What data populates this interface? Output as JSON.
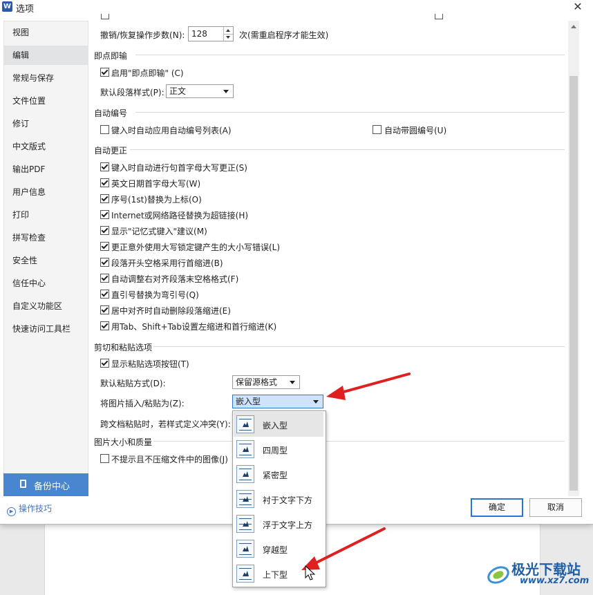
{
  "window": {
    "title": "选项",
    "app_logo": "W"
  },
  "sidebar": {
    "items": [
      {
        "label": "视图"
      },
      {
        "label": "编辑",
        "active": true
      },
      {
        "label": "常规与保存"
      },
      {
        "label": "文件位置"
      },
      {
        "label": "修订"
      },
      {
        "label": "中文版式"
      },
      {
        "label": "输出PDF"
      },
      {
        "label": "用户信息"
      },
      {
        "label": "打印"
      },
      {
        "label": "拼写检查"
      },
      {
        "label": "安全性"
      },
      {
        "label": "信任中心"
      },
      {
        "label": "自定义功能区"
      },
      {
        "label": "快速访问工具栏"
      }
    ],
    "backup_label": "备份中心",
    "tips_label": "操作技巧"
  },
  "content": {
    "undo": {
      "label": "撤销/恢复操作步数(N):",
      "value": "128",
      "note": "次(需重启程序才能生效)"
    },
    "click_type": {
      "title": "即点即输",
      "enable_label": "启用\"即点即输\" (C)",
      "enable_checked": true,
      "style_label": "默认段落样式(P):",
      "style_value": "正文"
    },
    "auto_number": {
      "title": "自动编号",
      "opt1": "键入时自动应用自动编号列表(A)",
      "opt1_checked": false,
      "opt2": "自动带圆编号(U)",
      "opt2_checked": false
    },
    "auto_correct": {
      "title": "自动更正",
      "options": [
        {
          "label": "键入时自动进行句首字母大写更正(S)",
          "checked": true
        },
        {
          "label": "英文日期首字母大写(W)",
          "checked": true
        },
        {
          "label": "序号(1st)替换为上标(O)",
          "checked": true
        },
        {
          "label": "Internet或网络路径替换为超链接(H)",
          "checked": true
        },
        {
          "label": "显示\"记忆式键入\"建议(M)",
          "checked": true
        },
        {
          "label": "更正意外使用大写锁定键产生的大小写错误(L)",
          "checked": true
        },
        {
          "label": "段落开头空格采用行首缩进(B)",
          "checked": true
        },
        {
          "label": "自动调整右对齐段落末空格格式(F)",
          "checked": true
        },
        {
          "label": "直引号替换为弯引号(Q)",
          "checked": true
        },
        {
          "label": "居中对齐时自动删除段落缩进(E)",
          "checked": true
        },
        {
          "label": "用Tab、Shift+Tab设置左缩进和首行缩进(K)",
          "checked": true
        }
      ]
    },
    "paste": {
      "title": "剪切和粘贴选项",
      "show_btn_label": "显示粘贴选项按钮(T)",
      "show_btn_checked": true,
      "default_label": "默认粘贴方式(D):",
      "default_value": "保留源格式",
      "image_label": "将图片插入/粘贴为(Z):",
      "image_value": "嵌入型",
      "conflict_label": "跨文档粘贴时，若样式定义冲突(Y):"
    },
    "image_quality": {
      "title": "图片大小和质量",
      "no_compress_label": "不提示且不压缩文件中的图像(J)",
      "no_compress_checked": false
    }
  },
  "dropdown": {
    "options": [
      {
        "label": "嵌入型",
        "icon": "inline-wrap-icon",
        "highlighted": true
      },
      {
        "label": "四周型",
        "icon": "square-wrap-icon"
      },
      {
        "label": "紧密型",
        "icon": "tight-wrap-icon"
      },
      {
        "label": "衬于文字下方",
        "icon": "behind-text-icon"
      },
      {
        "label": "浮于文字上方",
        "icon": "in-front-text-icon"
      },
      {
        "label": "穿越型",
        "icon": "through-wrap-icon"
      },
      {
        "label": "上下型",
        "icon": "top-bottom-wrap-icon"
      }
    ]
  },
  "buttons": {
    "ok": "确定",
    "cancel": "取消"
  },
  "watermark": {
    "title": "极光下载站",
    "url": "www.xz7.com"
  },
  "colors": {
    "accent": "#4a86cf",
    "annotation_arrow": "#e02020"
  }
}
